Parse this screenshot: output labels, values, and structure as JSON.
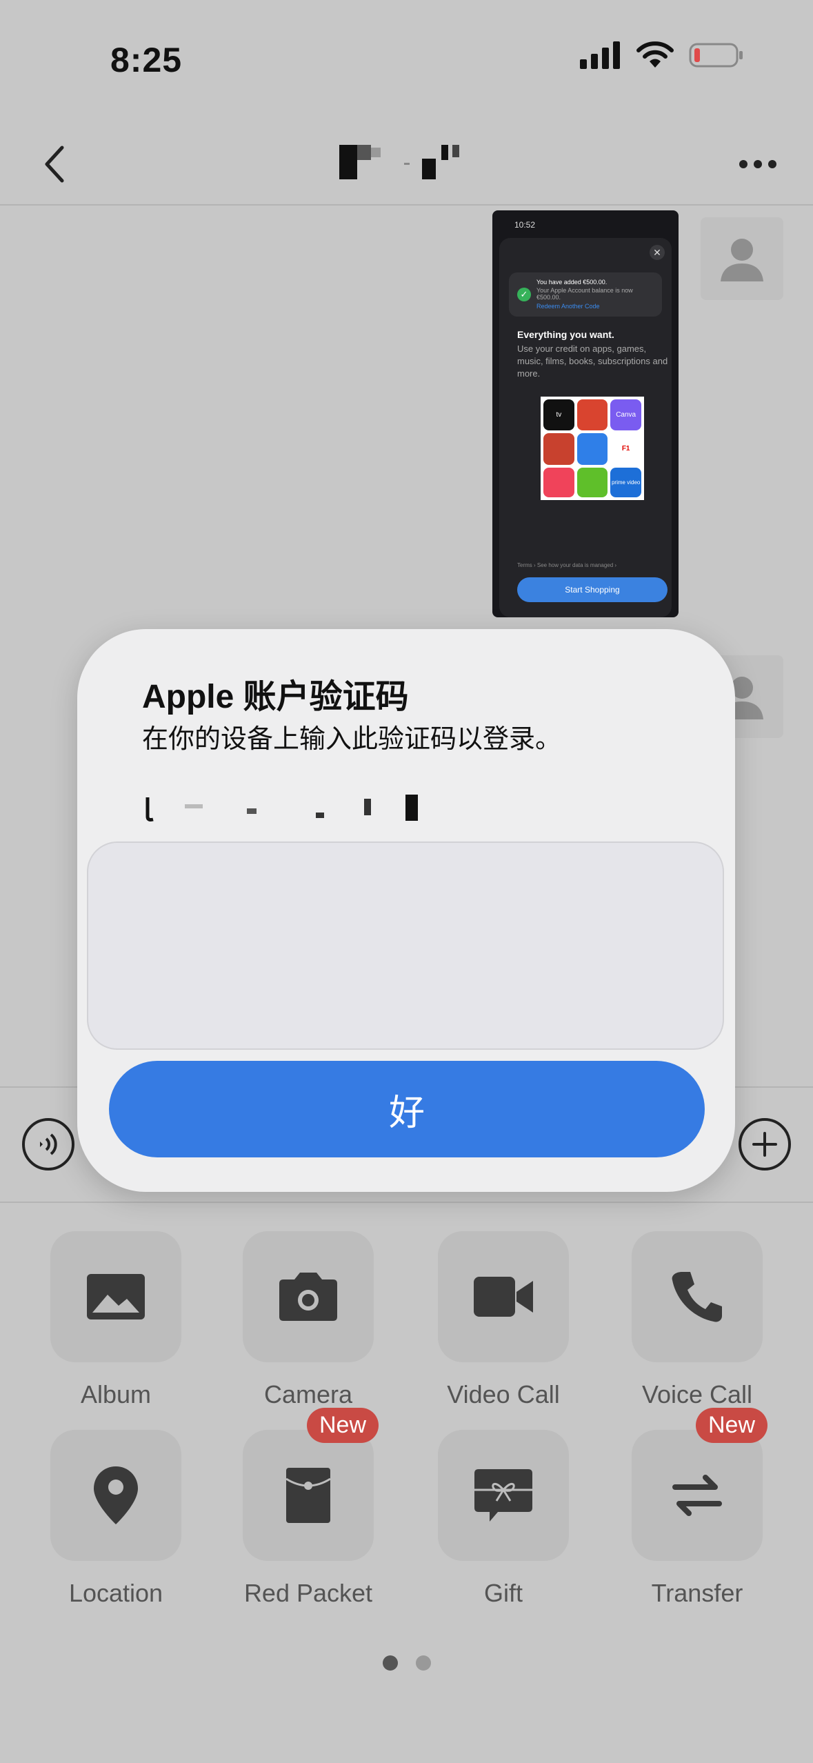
{
  "status_bar": {
    "time": "8:25"
  },
  "chat": {
    "screenshot": {
      "time": "10:52",
      "toast_title": "You have added €500.00.",
      "toast_body": "Your Apple Account balance is now €500.00.",
      "toast_link": "Redeem Another Code",
      "heading": "Everything you want.",
      "body": "Use your credit on apps, games, music, films, books, subscriptions and more.",
      "apps": [
        "tv",
        "",
        "Canva",
        "",
        "",
        "",
        "",
        "",
        "prime video"
      ],
      "links": "Terms ›    See how your data is managed ›",
      "button": "Start Shopping"
    }
  },
  "dialog": {
    "title": "Apple 账户验证码",
    "subtitle": "在你的设备上输入此验证码以登录。",
    "ok_label": "好"
  },
  "actions": [
    {
      "label": "Album",
      "icon": "image-icon"
    },
    {
      "label": "Camera",
      "icon": "camera-icon"
    },
    {
      "label": "Video Call",
      "icon": "video-camera-icon"
    },
    {
      "label": "Voice Call",
      "icon": "phone-icon"
    },
    {
      "label": "Location",
      "icon": "location-pin-icon"
    },
    {
      "label": "Red Packet",
      "icon": "red-packet-icon",
      "badge": "New"
    },
    {
      "label": "Gift",
      "icon": "gift-icon"
    },
    {
      "label": "Transfer",
      "icon": "transfer-arrows-icon",
      "badge": "New"
    }
  ],
  "colors": {
    "accent": "#367be3",
    "badge": "#c94a44",
    "battery_low": "#e04a4a"
  }
}
